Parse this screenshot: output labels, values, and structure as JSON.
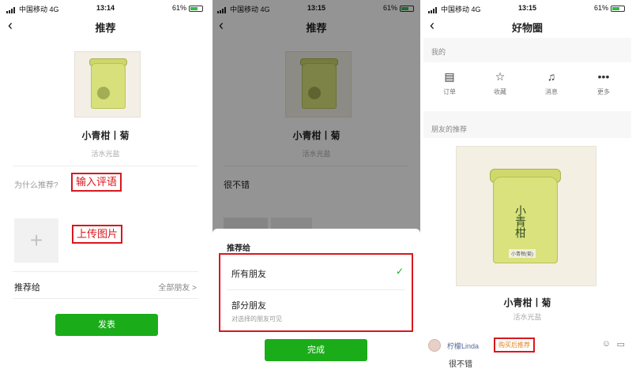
{
  "colors": {
    "accent_green": "#1aad19",
    "annotation_red": "#d9171e",
    "link_blue": "#576b95"
  },
  "status_bar": {
    "carrier": "中国移动",
    "network": "4G",
    "battery": "61%",
    "times": [
      "13:14",
      "13:15",
      "13:15"
    ]
  },
  "panel1": {
    "title": "推荐",
    "product_name": "小青柑丨菊",
    "product_sub": "活水光盐",
    "why_label": "为什么推荐?",
    "comment_annotation": "输入评语",
    "upload_annotation": "上传图片",
    "upload_icon": "plus-icon",
    "recommend_to_label": "推荐给",
    "recommend_to_value": "全部朋友 >",
    "publish_button": "发表"
  },
  "panel2": {
    "title": "推荐",
    "product_name": "小青柑丨菊",
    "product_sub": "活水光盐",
    "comment_text": "很不错",
    "sheet_title": "推荐给",
    "option_all": "所有朋友",
    "option_partial": "部分朋友",
    "option_partial_sub": "对选择的朋友可见",
    "done_button": "完成"
  },
  "panel3": {
    "title": "好物圈",
    "mine_label": "我的",
    "menu": [
      {
        "label": "订单",
        "icon": "order-icon"
      },
      {
        "label": "收藏",
        "icon": "star-icon"
      },
      {
        "label": "消息",
        "icon": "bell-icon"
      },
      {
        "label": "更多",
        "icon": "more-icon"
      }
    ],
    "friends_label": "朋友的推荐",
    "product_name": "小青柑丨菊",
    "product_sub": "活水光盐",
    "tin_text": "小青柑",
    "tin_label": "小青柑(菊)",
    "user_name": "柠檬Linda",
    "buy_badge": "购买后推荐",
    "comment": "很不错"
  }
}
